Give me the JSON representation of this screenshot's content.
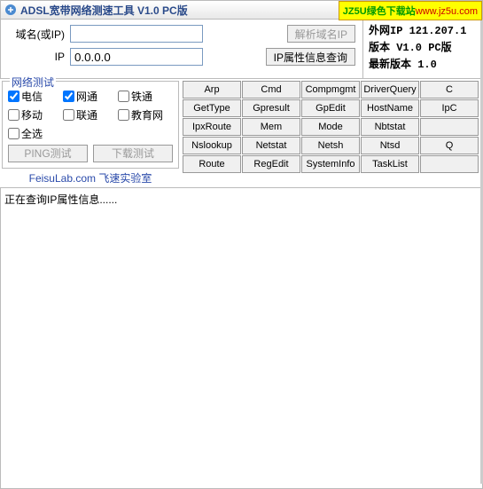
{
  "window": {
    "title": "ADSL宽带网络测速工具 V1.0 PC版"
  },
  "watermark": {
    "green": "JZ5U绿色下载站",
    "url": "www.jz5u.com"
  },
  "inputs": {
    "domain_label": "域名(或IP)",
    "domain_value": "",
    "resolve_btn": "解析域名IP",
    "ip_label": "IP",
    "ip_value": "0.0.0.0",
    "ipinfo_btn": "IP属性信息查询"
  },
  "info": {
    "wan": "外网IP 121.207.1",
    "ver": "版本  V1.0 PC版",
    "latest": "最新版本  1.0"
  },
  "test": {
    "legend": "网络测试",
    "checks": [
      "电信",
      "网通",
      "铁通",
      "移动",
      "联通",
      "教育网"
    ],
    "checked": [
      true,
      true,
      false,
      false,
      false,
      false
    ],
    "selectall": "全选",
    "ping_btn": "PING测试",
    "dl_btn": "下载测试",
    "footer": "FeisuLab.com 飞速实验室"
  },
  "commands": [
    "Arp",
    "Cmd",
    "Compmgmt",
    "DriverQuery",
    "C",
    "GetType",
    "Gpresult",
    "GpEdit",
    "HostName",
    "IpC",
    "IpxRoute",
    "Mem",
    "Mode",
    "Nbtstat",
    "",
    "Nslookup",
    "Netstat",
    "Netsh",
    "Ntsd",
    "Q",
    "Route",
    "RegEdit",
    "SystemInfo",
    "TaskList",
    ""
  ],
  "output": "正在查询IP属性信息......"
}
